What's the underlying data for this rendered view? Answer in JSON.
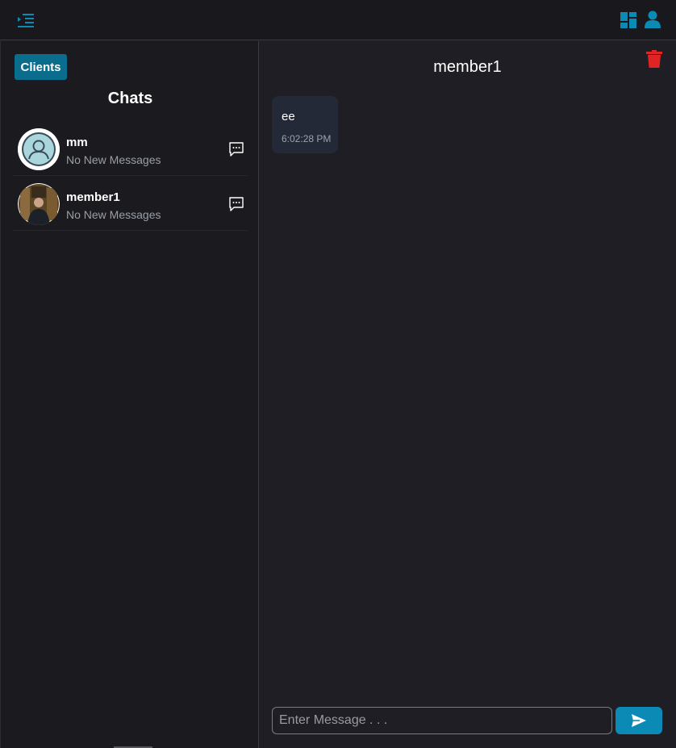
{
  "header": {
    "menu_icon": "sidebar-toggle-icon",
    "dashboard_icon": "dashboard-icon",
    "user_icon": "user-icon",
    "accent_color": "#0a8ab4"
  },
  "sidebar": {
    "clients_label": "Clients",
    "title": "Chats",
    "chats": [
      {
        "name": "mm",
        "status": "No New Messages",
        "avatar": "default-avatar-icon"
      },
      {
        "name": "member1",
        "status": "No New Messages",
        "avatar": "user-photo"
      }
    ]
  },
  "conversation": {
    "title": "member1",
    "delete_icon": "trash-icon",
    "delete_color": "#e02424",
    "messages": [
      {
        "text": "ee",
        "time": "6:02:28 PM"
      }
    ],
    "input_placeholder": "Enter Message . . .",
    "send_icon": "send-icon"
  }
}
